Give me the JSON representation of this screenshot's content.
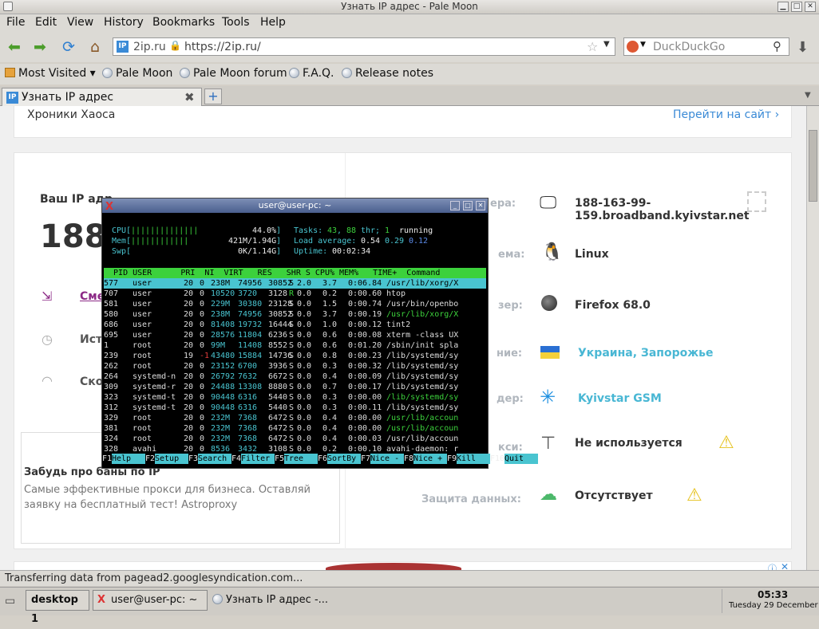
{
  "window": {
    "title": "Узнать IP адрес - Pale Moon"
  },
  "menu": [
    "File",
    "Edit",
    "View",
    "History",
    "Bookmarks",
    "Tools",
    "Help"
  ],
  "urlbar": {
    "site_badge": "2ip.ru",
    "url": "https://2ip.ru/"
  },
  "search": {
    "engine": "DuckDuckGo"
  },
  "bookmarks": {
    "most_visited": "Most Visited",
    "items": [
      "Pale Moon",
      "Pale Moon forum",
      "F.A.Q.",
      "Release notes"
    ]
  },
  "tab": {
    "title": "Узнать IP адрес",
    "new_tab": "+"
  },
  "page": {
    "promo_title": "Хроники Хаоса",
    "promo_link": "Перейти на сайт",
    "ip_label": "Ваш IP адр",
    "ip_value": "188.",
    "change_link": "Сме",
    "history_link": "Ист",
    "speed_link": "Ско",
    "ad_title": "Забудь про баны по IP",
    "ad_text": "Самые эффективные прокси для бизнеса. Оставляй заявку на бесплатный тест! Astroproxy",
    "info_rows": [
      {
        "label": "ера:",
        "value": "188-163-99-159.broadband.kyivstar.net",
        "icon": "monitor-icon"
      },
      {
        "label": "ема:",
        "value": "Linux",
        "icon": "tux-icon"
      },
      {
        "label": "зер:",
        "value": "Firefox 68.0",
        "icon": "firefox-icon"
      },
      {
        "label": "ние:",
        "value": "Украина, Запорожье",
        "icon": "ukraine-flag-icon"
      },
      {
        "label": "дер:",
        "value": "Kyivstar GSM",
        "icon": "kyivstar-icon"
      },
      {
        "label": "кси:",
        "value": "Не используется",
        "icon": "network-icon"
      },
      {
        "label": "Защита данных:",
        "value": "Отсутствует",
        "icon": "lock-icon"
      }
    ]
  },
  "terminal": {
    "title": "user@user-pc: ~",
    "cpu_bar": "||||||||||||||",
    "cpu_pct": "44.0%",
    "mem_bar": "||||||||||||",
    "mem_val": "421M/1.94G",
    "swp_val": "0K/1.14G",
    "tasks": "43",
    "thr": "88",
    "running": "1",
    "load": [
      "0.54",
      "0.29",
      "0.12"
    ],
    "uptime": "00:02:34",
    "header": "  PID USER      PRI  NI  VIRT   RES   SHR S CPU% MEM%   TIME+  Command",
    "procs": [
      [
        "577",
        "user",
        "20",
        "0",
        "238M",
        "74956",
        "30852",
        "S",
        "2.0",
        "3.7",
        "0:06.84",
        "/usr/lib/xorg/X"
      ],
      [
        "707",
        "user",
        "20",
        "0",
        "10520",
        "3720",
        "3128",
        "R",
        "0.0",
        "0.2",
        "0:00.60",
        "htop"
      ],
      [
        "581",
        "user",
        "20",
        "0",
        "229M",
        "30380",
        "23128",
        "S",
        "0.0",
        "1.5",
        "0:00.74",
        "/usr/bin/openbo"
      ],
      [
        "580",
        "user",
        "20",
        "0",
        "238M",
        "74956",
        "30852",
        "S",
        "0.0",
        "3.7",
        "0:00.19",
        "/usr/lib/xorg/X"
      ],
      [
        "686",
        "user",
        "20",
        "0",
        "81408",
        "19732",
        "16444",
        "S",
        "0.0",
        "1.0",
        "0:00.12",
        "tint2"
      ],
      [
        "695",
        "user",
        "20",
        "0",
        "28576",
        "11804",
        "6236",
        "S",
        "0.0",
        "0.6",
        "0:00.08",
        "xterm -class UX"
      ],
      [
        "1",
        "root",
        "20",
        "0",
        "99M",
        "11408",
        "8552",
        "S",
        "0.0",
        "0.6",
        "0:01.20",
        "/sbin/init spla"
      ],
      [
        "239",
        "root",
        "19",
        "-1",
        "43480",
        "15884",
        "14736",
        "S",
        "0.0",
        "0.8",
        "0:00.23",
        "/lib/systemd/sy"
      ],
      [
        "262",
        "root",
        "20",
        "0",
        "23152",
        "6700",
        "3936",
        "S",
        "0.0",
        "0.3",
        "0:00.32",
        "/lib/systemd/sy"
      ],
      [
        "264",
        "systemd-n",
        "20",
        "0",
        "26792",
        "7632",
        "6672",
        "S",
        "0.0",
        "0.4",
        "0:00.09",
        "/lib/systemd/sy"
      ],
      [
        "309",
        "systemd-r",
        "20",
        "0",
        "24488",
        "13308",
        "8880",
        "S",
        "0.0",
        "0.7",
        "0:00.17",
        "/lib/systemd/sy"
      ],
      [
        "323",
        "systemd-t",
        "20",
        "0",
        "90448",
        "6316",
        "5440",
        "S",
        "0.0",
        "0.3",
        "0:00.00",
        "/lib/systemd/sy"
      ],
      [
        "312",
        "systemd-t",
        "20",
        "0",
        "90448",
        "6316",
        "5440",
        "S",
        "0.0",
        "0.3",
        "0:00.11",
        "/lib/systemd/sy"
      ],
      [
        "329",
        "root",
        "20",
        "0",
        "232M",
        "7368",
        "6472",
        "S",
        "0.0",
        "0.4",
        "0:00.00",
        "/usr/lib/accoun"
      ],
      [
        "381",
        "root",
        "20",
        "0",
        "232M",
        "7368",
        "6472",
        "S",
        "0.0",
        "0.4",
        "0:00.00",
        "/usr/lib/accoun"
      ],
      [
        "324",
        "root",
        "20",
        "0",
        "232M",
        "7368",
        "6472",
        "S",
        "0.0",
        "0.4",
        "0:00.03",
        "/usr/lib/accoun"
      ],
      [
        "328",
        "avahi",
        "20",
        "0",
        "8536",
        "3432",
        "3108",
        "S",
        "0.0",
        "0.2",
        "0:00.10",
        "avahi-daemon: r"
      ]
    ],
    "fkeys": [
      [
        "F1",
        "Help"
      ],
      [
        "F2",
        "Setup"
      ],
      [
        "F3",
        "Search"
      ],
      [
        "F4",
        "Filter"
      ],
      [
        "F5",
        "Tree"
      ],
      [
        "F6",
        "SortBy"
      ],
      [
        "F7",
        "Nice -"
      ],
      [
        "F8",
        "Nice +"
      ],
      [
        "F9",
        "Kill"
      ],
      [
        "F10",
        "Quit"
      ]
    ]
  },
  "status": {
    "text": "Transferring data from pagead2.googlesyndication.com..."
  },
  "taskbar": {
    "desktop": "desktop 1",
    "task1": "user@user-pc: ~",
    "task2": "Узнать IP адрес -...",
    "time": "05:33",
    "date": "Tuesday 29 December"
  }
}
